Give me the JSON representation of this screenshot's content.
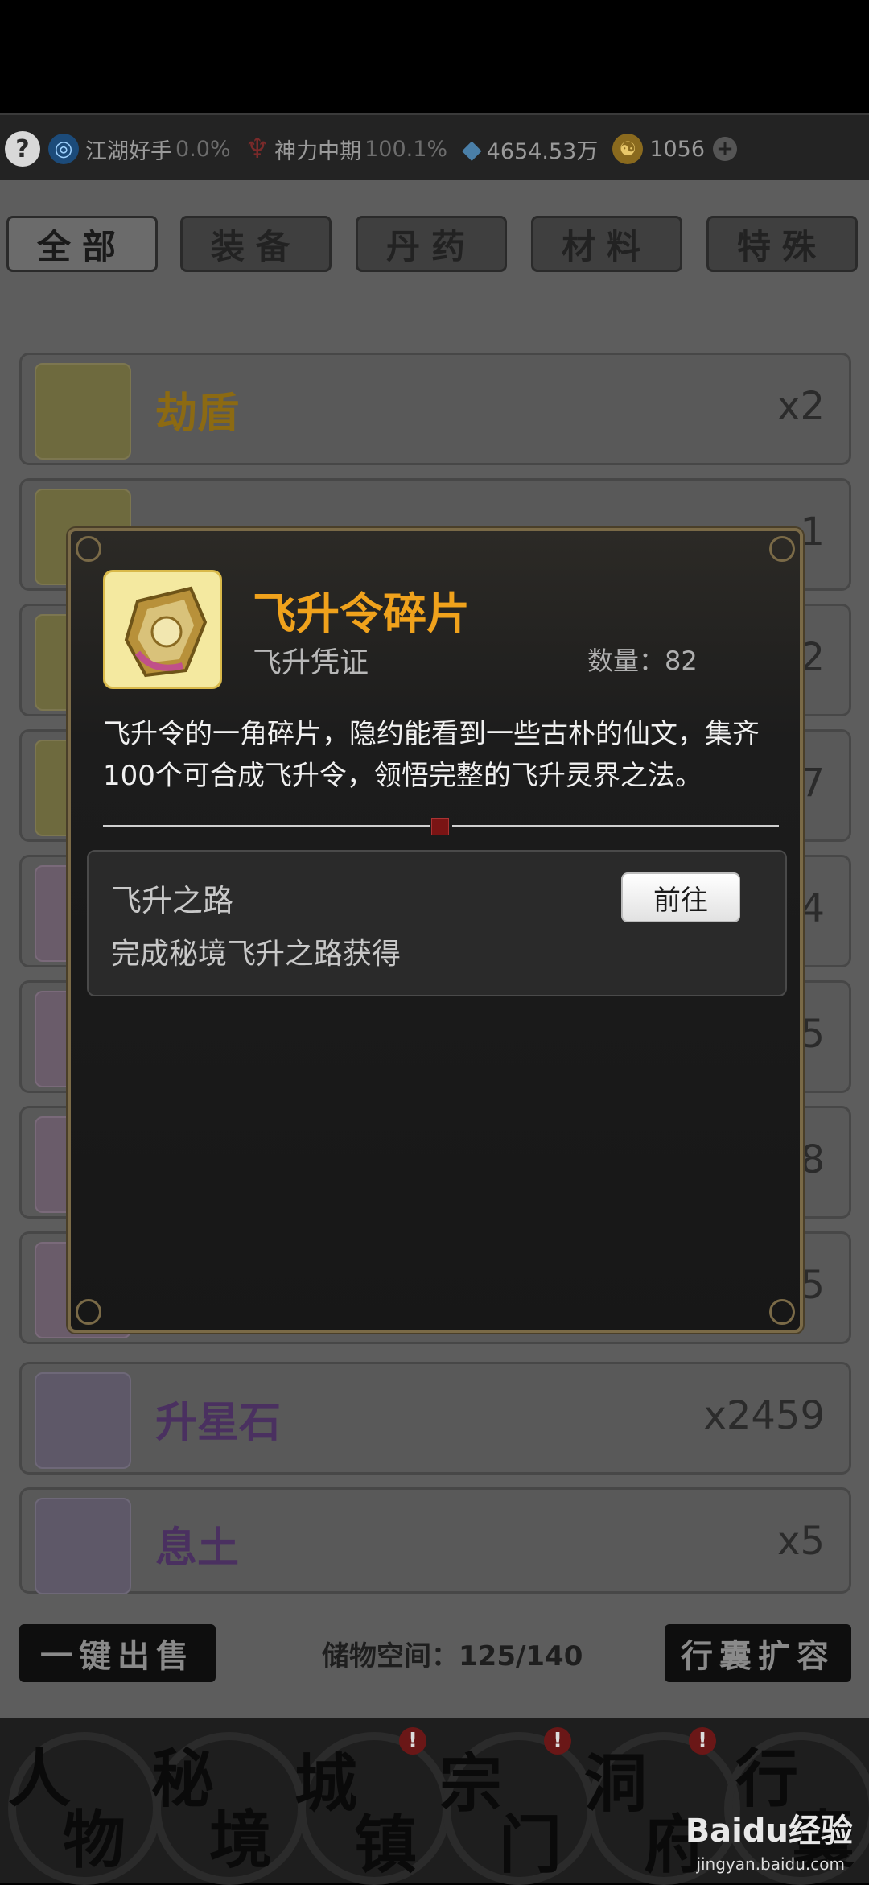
{
  "status": {
    "help": "?",
    "cultivation_label": "江湖好手",
    "cultivation_pct": "0.0%",
    "power_label": "神力中期",
    "power_pct": "100.1%",
    "spirit_stones": "4654.53万",
    "gold": "1056",
    "add": "+"
  },
  "tabs": [
    {
      "label": "全部",
      "active": true
    },
    {
      "label": "装备",
      "active": false
    },
    {
      "label": "丹药",
      "active": false
    },
    {
      "label": "材料",
      "active": false
    },
    {
      "label": "特殊",
      "active": false
    }
  ],
  "items": [
    {
      "name": "劫盾",
      "count": "x2",
      "color": "#8c6a12"
    },
    {
      "name": "",
      "count": "1",
      "color": "#8c6a12"
    },
    {
      "name": "",
      "count": "2",
      "color": "#8c6a12"
    },
    {
      "name": "",
      "count": "7",
      "color": "#8c6a12"
    },
    {
      "name": "",
      "count": "4",
      "color": "#6b4a6b"
    },
    {
      "name": "",
      "count": "x5",
      "color": "#6b4a6b"
    },
    {
      "name": "",
      "count": "78",
      "color": "#6b4a6b"
    },
    {
      "name": "",
      "count": "5",
      "color": "#6b4a6b"
    },
    {
      "name": "升星石",
      "count": "x2459",
      "color": "#5a3a72"
    },
    {
      "name": "息土",
      "count": "x5",
      "color": "#5a3a72"
    }
  ],
  "footer": {
    "sell_all": "一键出售",
    "storage": "储物空间：125/140",
    "expand": "行囊扩容"
  },
  "nav": [
    {
      "line1": "人",
      "line2": "物",
      "badge": ""
    },
    {
      "line1": "秘",
      "line2": "境",
      "badge": ""
    },
    {
      "line1": "城",
      "line2": "镇",
      "badge": "!"
    },
    {
      "line1": "宗",
      "line2": "门",
      "badge": "!"
    },
    {
      "line1": "洞",
      "line2": "府",
      "badge": "!"
    },
    {
      "line1": "行",
      "line2": "囊",
      "badge": ""
    }
  ],
  "modal": {
    "name": "飞升令碎片",
    "type": "飞升凭证",
    "quantity": "数量：82",
    "description": "飞升令的一角碎片，隐约能看到一些古朴的仙文，集齐100个可合成飞升令，领悟完整的飞升灵界之法。",
    "source": {
      "title": "飞升之路",
      "desc": "完成秘境飞升之路获得",
      "button": "前往"
    }
  },
  "watermark": {
    "logo": "Baidu经验",
    "url": "jingyan.baidu.com"
  },
  "colors": {
    "accent": "#f0a21c",
    "badge": "#6a1717"
  }
}
